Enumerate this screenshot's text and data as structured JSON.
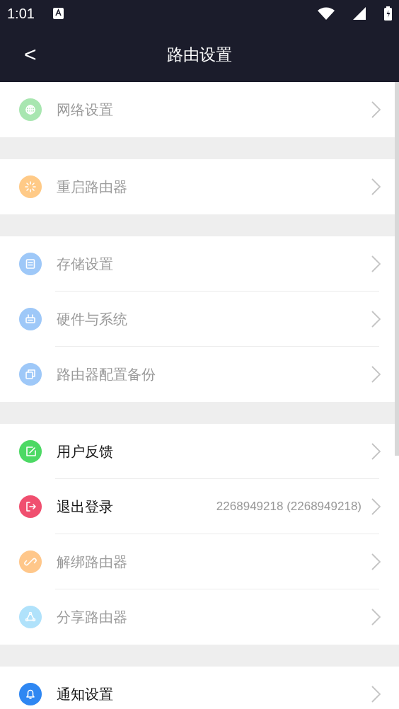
{
  "status_bar": {
    "time": "1:01"
  },
  "header": {
    "back": "<",
    "title": "路由设置"
  },
  "sections": [
    {
      "items": [
        {
          "label": "网络设置",
          "kind": "globe",
          "color": "#a8e6b0",
          "disabled": true
        }
      ]
    },
    {
      "items": [
        {
          "label": "重启路由器",
          "kind": "restart",
          "color": "#ffca87",
          "disabled": true
        }
      ]
    },
    {
      "items": [
        {
          "label": "存储设置",
          "kind": "storage",
          "color": "#9ec8f8",
          "disabled": true
        },
        {
          "label": "硬件与系统",
          "kind": "hardware",
          "color": "#9ec8f8",
          "disabled": true
        },
        {
          "label": "路由器配置备份",
          "kind": "backup",
          "color": "#9ec8f8",
          "disabled": true
        }
      ]
    },
    {
      "items": [
        {
          "label": "用户反馈",
          "kind": "feedback",
          "color": "#4cd964",
          "disabled": false
        },
        {
          "label": "退出登录",
          "kind": "logout",
          "color": "#f04f6f",
          "disabled": false,
          "value": "2268949218 (2268949218)"
        },
        {
          "label": "解绑路由器",
          "kind": "unlink",
          "color": "#ffc78a",
          "disabled": true
        },
        {
          "label": "分享路由器",
          "kind": "share",
          "color": "#b0e2fb",
          "disabled": true
        }
      ]
    },
    {
      "items": [
        {
          "label": "通知设置",
          "kind": "bell",
          "color": "#2f87f2",
          "disabled": false
        }
      ]
    }
  ]
}
